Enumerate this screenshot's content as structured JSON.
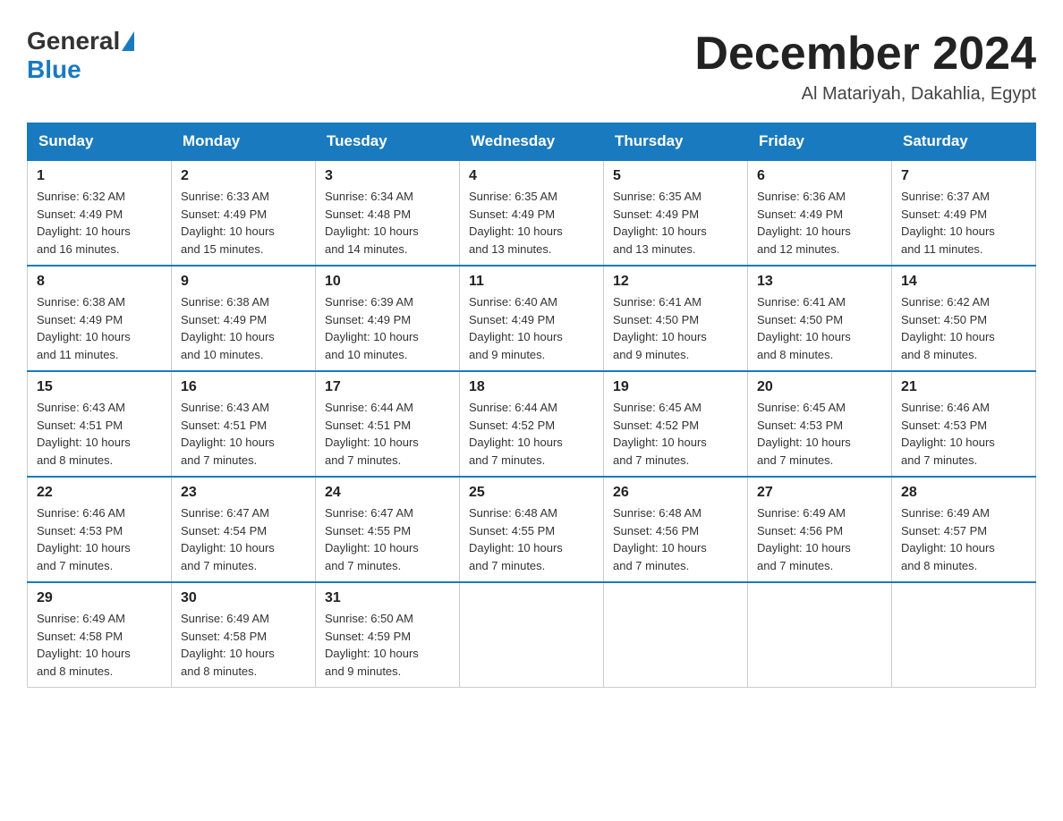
{
  "header": {
    "logo_general": "General",
    "logo_blue": "Blue",
    "month_title": "December 2024",
    "location": "Al Matariyah, Dakahlia, Egypt"
  },
  "days_of_week": [
    "Sunday",
    "Monday",
    "Tuesday",
    "Wednesday",
    "Thursday",
    "Friday",
    "Saturday"
  ],
  "weeks": [
    [
      {
        "day": "1",
        "sunrise": "6:32 AM",
        "sunset": "4:49 PM",
        "daylight": "10 hours and 16 minutes."
      },
      {
        "day": "2",
        "sunrise": "6:33 AM",
        "sunset": "4:49 PM",
        "daylight": "10 hours and 15 minutes."
      },
      {
        "day": "3",
        "sunrise": "6:34 AM",
        "sunset": "4:48 PM",
        "daylight": "10 hours and 14 minutes."
      },
      {
        "day": "4",
        "sunrise": "6:35 AM",
        "sunset": "4:49 PM",
        "daylight": "10 hours and 13 minutes."
      },
      {
        "day": "5",
        "sunrise": "6:35 AM",
        "sunset": "4:49 PM",
        "daylight": "10 hours and 13 minutes."
      },
      {
        "day": "6",
        "sunrise": "6:36 AM",
        "sunset": "4:49 PM",
        "daylight": "10 hours and 12 minutes."
      },
      {
        "day": "7",
        "sunrise": "6:37 AM",
        "sunset": "4:49 PM",
        "daylight": "10 hours and 11 minutes."
      }
    ],
    [
      {
        "day": "8",
        "sunrise": "6:38 AM",
        "sunset": "4:49 PM",
        "daylight": "10 hours and 11 minutes."
      },
      {
        "day": "9",
        "sunrise": "6:38 AM",
        "sunset": "4:49 PM",
        "daylight": "10 hours and 10 minutes."
      },
      {
        "day": "10",
        "sunrise": "6:39 AM",
        "sunset": "4:49 PM",
        "daylight": "10 hours and 10 minutes."
      },
      {
        "day": "11",
        "sunrise": "6:40 AM",
        "sunset": "4:49 PM",
        "daylight": "10 hours and 9 minutes."
      },
      {
        "day": "12",
        "sunrise": "6:41 AM",
        "sunset": "4:50 PM",
        "daylight": "10 hours and 9 minutes."
      },
      {
        "day": "13",
        "sunrise": "6:41 AM",
        "sunset": "4:50 PM",
        "daylight": "10 hours and 8 minutes."
      },
      {
        "day": "14",
        "sunrise": "6:42 AM",
        "sunset": "4:50 PM",
        "daylight": "10 hours and 8 minutes."
      }
    ],
    [
      {
        "day": "15",
        "sunrise": "6:43 AM",
        "sunset": "4:51 PM",
        "daylight": "10 hours and 8 minutes."
      },
      {
        "day": "16",
        "sunrise": "6:43 AM",
        "sunset": "4:51 PM",
        "daylight": "10 hours and 7 minutes."
      },
      {
        "day": "17",
        "sunrise": "6:44 AM",
        "sunset": "4:51 PM",
        "daylight": "10 hours and 7 minutes."
      },
      {
        "day": "18",
        "sunrise": "6:44 AM",
        "sunset": "4:52 PM",
        "daylight": "10 hours and 7 minutes."
      },
      {
        "day": "19",
        "sunrise": "6:45 AM",
        "sunset": "4:52 PM",
        "daylight": "10 hours and 7 minutes."
      },
      {
        "day": "20",
        "sunrise": "6:45 AM",
        "sunset": "4:53 PM",
        "daylight": "10 hours and 7 minutes."
      },
      {
        "day": "21",
        "sunrise": "6:46 AM",
        "sunset": "4:53 PM",
        "daylight": "10 hours and 7 minutes."
      }
    ],
    [
      {
        "day": "22",
        "sunrise": "6:46 AM",
        "sunset": "4:53 PM",
        "daylight": "10 hours and 7 minutes."
      },
      {
        "day": "23",
        "sunrise": "6:47 AM",
        "sunset": "4:54 PM",
        "daylight": "10 hours and 7 minutes."
      },
      {
        "day": "24",
        "sunrise": "6:47 AM",
        "sunset": "4:55 PM",
        "daylight": "10 hours and 7 minutes."
      },
      {
        "day": "25",
        "sunrise": "6:48 AM",
        "sunset": "4:55 PM",
        "daylight": "10 hours and 7 minutes."
      },
      {
        "day": "26",
        "sunrise": "6:48 AM",
        "sunset": "4:56 PM",
        "daylight": "10 hours and 7 minutes."
      },
      {
        "day": "27",
        "sunrise": "6:49 AM",
        "sunset": "4:56 PM",
        "daylight": "10 hours and 7 minutes."
      },
      {
        "day": "28",
        "sunrise": "6:49 AM",
        "sunset": "4:57 PM",
        "daylight": "10 hours and 8 minutes."
      }
    ],
    [
      {
        "day": "29",
        "sunrise": "6:49 AM",
        "sunset": "4:58 PM",
        "daylight": "10 hours and 8 minutes."
      },
      {
        "day": "30",
        "sunrise": "6:49 AM",
        "sunset": "4:58 PM",
        "daylight": "10 hours and 8 minutes."
      },
      {
        "day": "31",
        "sunrise": "6:50 AM",
        "sunset": "4:59 PM",
        "daylight": "10 hours and 9 minutes."
      },
      null,
      null,
      null,
      null
    ]
  ],
  "labels": {
    "sunrise": "Sunrise:",
    "sunset": "Sunset:",
    "daylight": "Daylight:"
  }
}
